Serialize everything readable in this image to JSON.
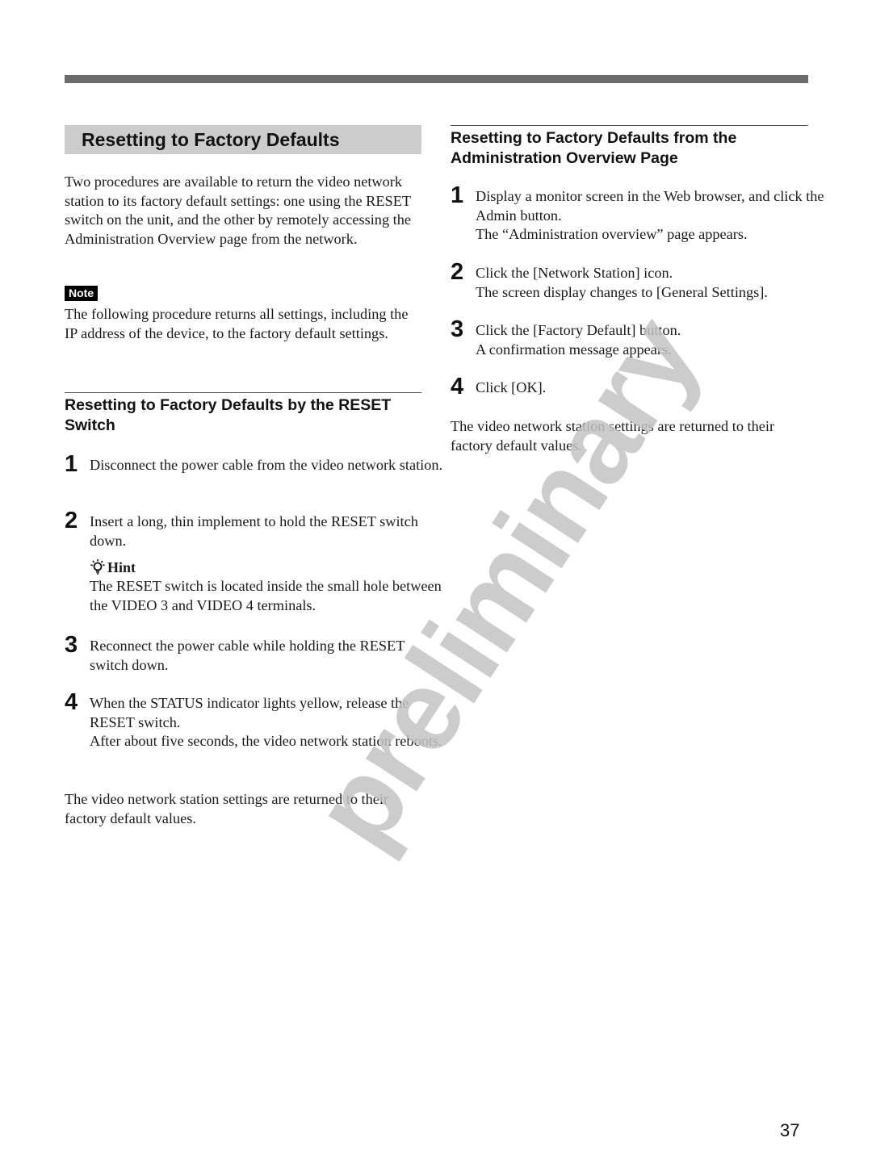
{
  "page": {
    "watermark": "preliminary",
    "page_number": "37"
  },
  "left": {
    "title": "Resetting to Factory Defaults",
    "intro": "Two procedures are available to return the video network station to its factory default settings: one using the RESET switch on the unit, and the other by remotely accessing the Administration Overview page from the network.",
    "note_label": "Note",
    "note_text": "The following procedure returns all settings, including the IP address of the device, to the factory default settings.",
    "subheading": "Resetting to Factory Defaults by the RESET Switch",
    "steps": [
      {
        "num": "1",
        "lines": [
          "Disconnect the power cable from the video network station."
        ]
      },
      {
        "num": "2",
        "lines": [
          "Insert a long, thin implement to hold the RESET switch down."
        ]
      },
      {
        "num": "3",
        "lines": [
          "Reconnect the power cable while holding the RESET switch down."
        ]
      },
      {
        "num": "4",
        "lines": [
          "When the STATUS indicator lights yellow, release the RESET switch.",
          "After about five seconds, the video network station reboots."
        ]
      }
    ],
    "hint_label": "Hint",
    "hint_icon": "lightbulb-icon",
    "hint_text": "The RESET switch is located inside the small hole between the VIDEO 3 and VIDEO 4 terminals.",
    "conclusion": "The video network station settings are returned to their factory default values."
  },
  "right": {
    "subheading": "Resetting to Factory Defaults from the Administration Overview Page",
    "steps": [
      {
        "num": "1",
        "lines": [
          "Display a monitor screen in the Web browser, and click the Admin button.",
          "The “Administration overview” page appears."
        ]
      },
      {
        "num": "2",
        "lines": [
          "Click the [Network Station] icon.",
          "The screen display changes to [General Settings]."
        ]
      },
      {
        "num": "3",
        "lines": [
          "Click the [Factory Default] button.",
          "A confirmation message appears."
        ]
      },
      {
        "num": "4",
        "lines": [
          "Click [OK]."
        ]
      }
    ],
    "conclusion": "The video network station settings are returned to their factory default values."
  }
}
